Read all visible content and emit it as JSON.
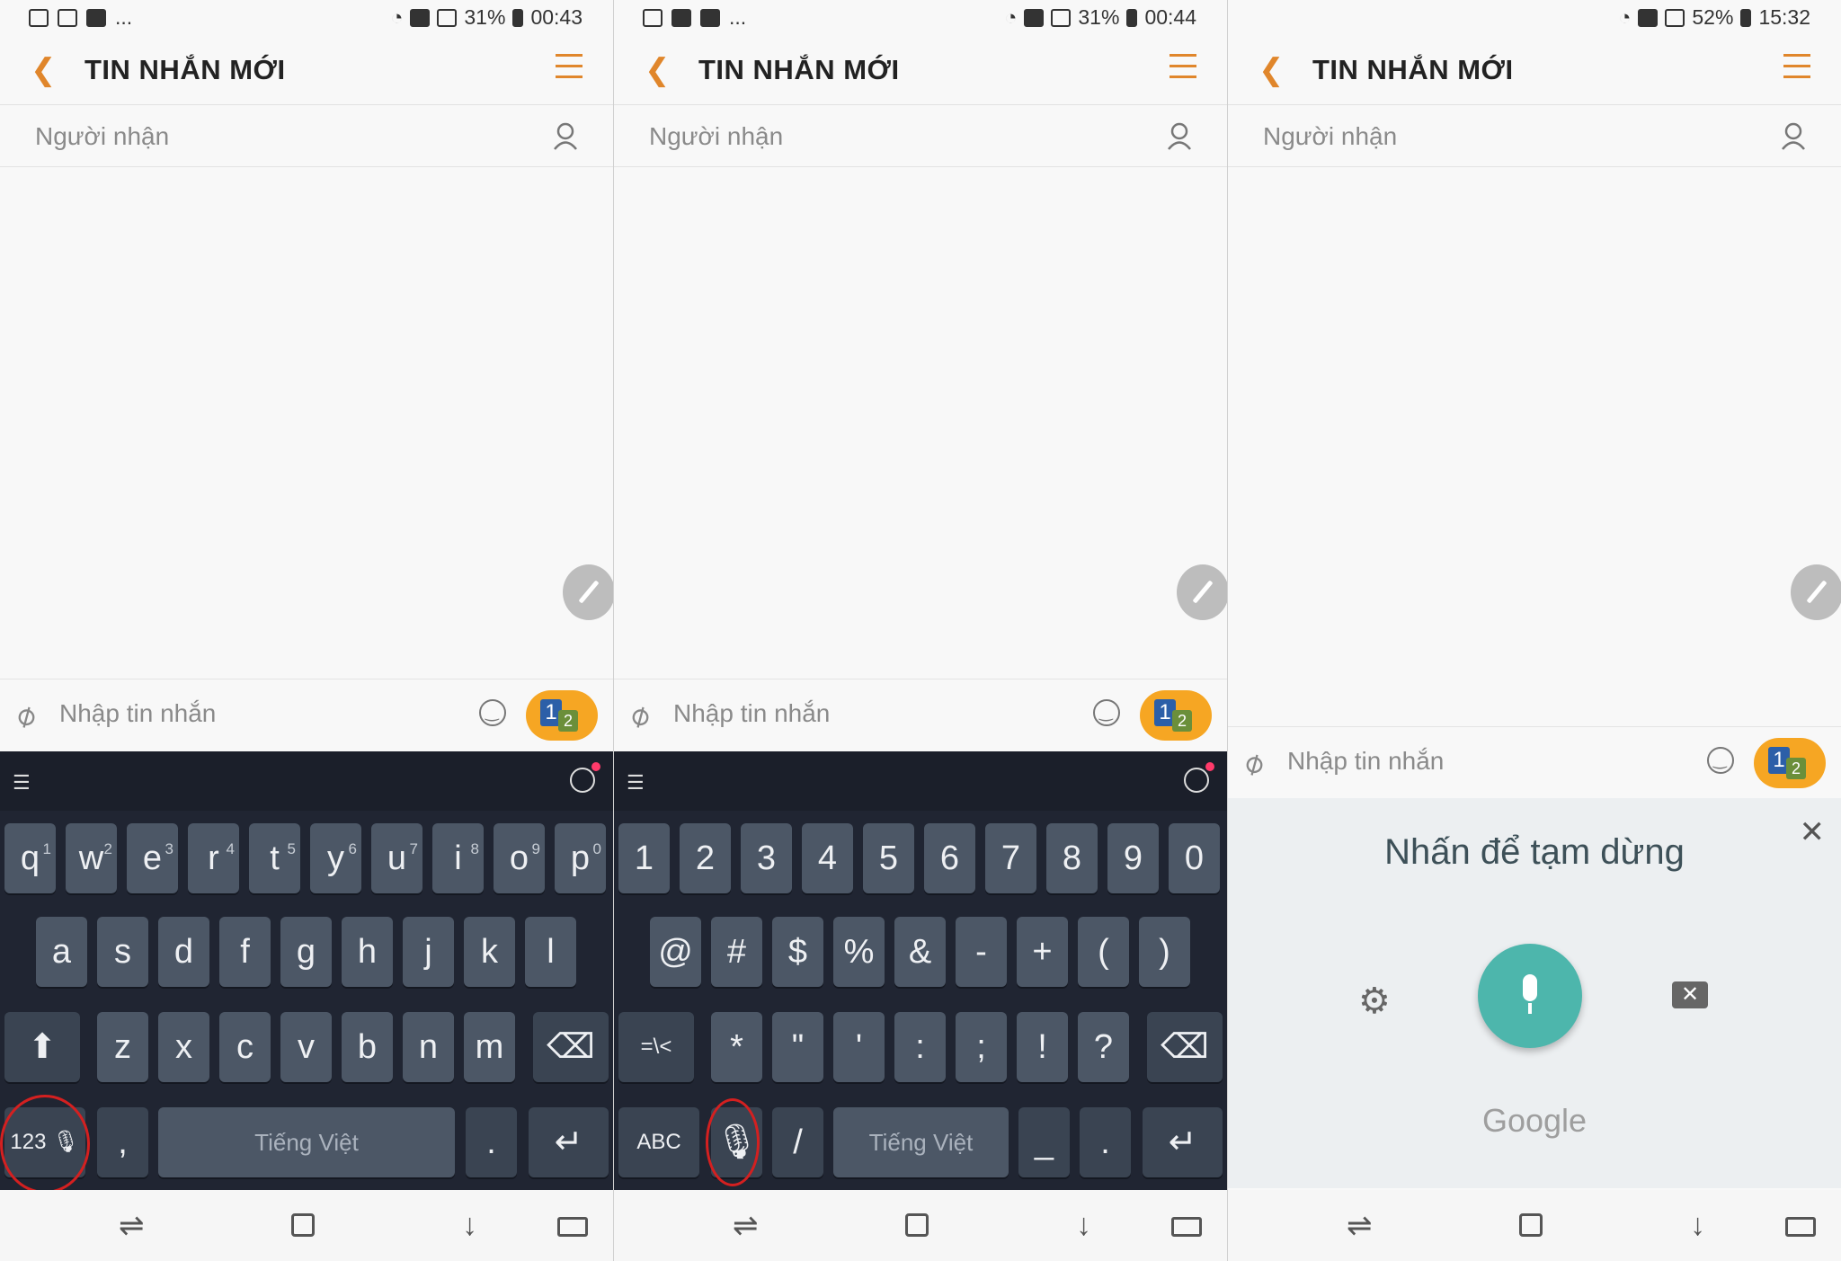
{
  "panels": [
    {
      "status_time": "00:43",
      "battery": "31%",
      "header_title": "TIN NHẮN MỚI",
      "recipient_placeholder": "Người nhận",
      "compose_placeholder": "Nhập tin nhắn",
      "sim_labels": [
        "1",
        "2"
      ],
      "keyboard": {
        "row1": [
          {
            "label": "q",
            "hint": "1"
          },
          {
            "label": "w",
            "hint": "2"
          },
          {
            "label": "e",
            "hint": "3"
          },
          {
            "label": "r",
            "hint": "4"
          },
          {
            "label": "t",
            "hint": "5"
          },
          {
            "label": "y",
            "hint": "6"
          },
          {
            "label": "u",
            "hint": "7"
          },
          {
            "label": "i",
            "hint": "8"
          },
          {
            "label": "o",
            "hint": "9"
          },
          {
            "label": "p",
            "hint": "0"
          }
        ],
        "row2": [
          "a",
          "s",
          "d",
          "f",
          "g",
          "h",
          "j",
          "k",
          "l"
        ],
        "row3": [
          "z",
          "x",
          "c",
          "v",
          "b",
          "n",
          "m"
        ],
        "mode_key": "123",
        "comma": ",",
        "space_label": "Tiếng Việt",
        "period": "."
      }
    },
    {
      "status_time": "00:44",
      "battery": "31%",
      "header_title": "TIN NHẮN MỚI",
      "recipient_placeholder": "Người nhận",
      "compose_placeholder": "Nhập tin nhắn",
      "sim_labels": [
        "1",
        "2"
      ],
      "keyboard": {
        "row1": [
          "1",
          "2",
          "3",
          "4",
          "5",
          "6",
          "7",
          "8",
          "9",
          "0"
        ],
        "row2": [
          "@",
          "#",
          "$",
          "%",
          "&",
          "-",
          "+",
          "(",
          ")"
        ],
        "row3": [
          "=\\<",
          "*",
          "\"",
          "'",
          ":",
          ";",
          "!",
          "?"
        ],
        "mode_key": "ABC",
        "slash": "/",
        "space_label": "Tiếng Việt",
        "underscore": "_",
        "period": "."
      }
    },
    {
      "status_time": "15:32",
      "battery": "52%",
      "header_title": "TIN NHẮN MỚI",
      "recipient_placeholder": "Người nhận",
      "compose_placeholder": "Nhập tin nhắn",
      "sim_labels": [
        "1",
        "2"
      ],
      "voice": {
        "title": "Nhấn để tạm dừng",
        "brand": "Google"
      }
    }
  ],
  "colors": {
    "accent": "#e0862b",
    "keyboard_bg": "#202532",
    "key_bg": "#4c5766",
    "voice_mic": "#4db6ac",
    "sim_badge": "#f6a623"
  }
}
